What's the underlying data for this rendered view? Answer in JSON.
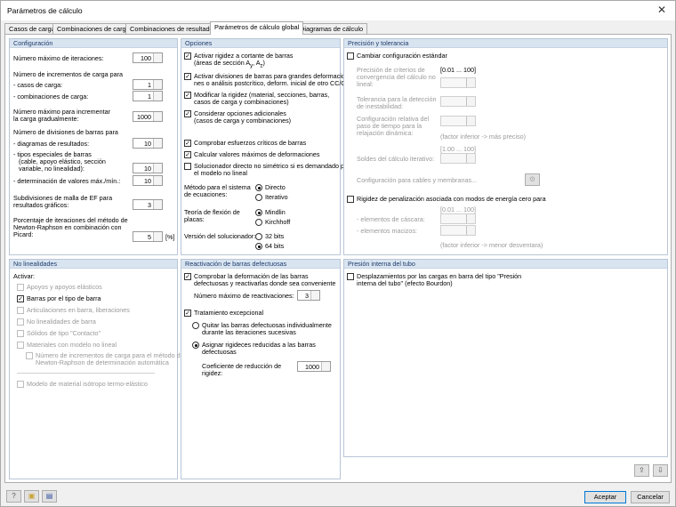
{
  "window": {
    "title": "Parámetros de cálculo",
    "close_icon": "close-icon"
  },
  "tabs": [
    "Casos de carga",
    "Combinaciones de carga",
    "Combinaciones de resultados",
    "Parámetros de cálculo global",
    "Diagramas de cálculo"
  ],
  "config": {
    "header": "Configuración",
    "max_iter_label": "Número máximo de iteraciones:",
    "max_iter": "100",
    "load_incr_label": "Número de incrementos de carga para",
    "load_cases_label": "- casos de carga:",
    "load_cases": "1",
    "load_combos_label": "- combinaciones de carga:",
    "load_combos": "1",
    "max_incr_label1": "Número máximo para incrementar",
    "max_incr_label2": "la carga gradualmente:",
    "max_incr": "1000",
    "member_div_label": "Número de divisiones de barras para",
    "result_diag_label": "- diagramas de resultados:",
    "result_diag": "10",
    "special_label1": "- tipos especiales de barras",
    "special_label2": "(cable, apoyo elástico, sección",
    "special_label3": "variable, no linealidad):",
    "special": "10",
    "max_min_label": "- determinación de valores máx./mín.:",
    "max_min": "10",
    "fe_label1": "Subdivisiones de malla de EF para",
    "fe_label2": "resultados gráficos:",
    "fe": "3",
    "pct_label1": "Porcentaje de iteraciones del método de",
    "pct_label2": "Newton-Raphson en combinación con",
    "pct_label3": "Picard:",
    "pct": "5",
    "pct_unit": "[%]"
  },
  "options": {
    "header": "Opciones",
    "opt1a": "Activar rigidez a cortante de barras",
    "opt1b": "(áreas de sección A",
    "opt1_sub1": "y",
    "opt1_sep": ", A",
    "opt1_sub2": "z",
    "opt1_close": ")",
    "opt2a": "Activar divisiones de barras para grandes deformacio-",
    "opt2b": "nes o análisis postcrítico, deform. inicial de otro CC/CO",
    "opt3a": "Modificar la rigidez (material, secciones, barras,",
    "opt3b": "casos de carga y combinaciones)",
    "opt4a": "Considerar opciones adicionales",
    "opt4b": "(casos de carga y combinaciones)",
    "opt5": "Comprobar esfuerzos críticos de barras",
    "opt6": "Calcular valores máximos de deformaciones",
    "opt7a": "Solucionador directo no simétrico si es demandado por",
    "opt7b": "el modelo no lineal",
    "method_label1": "Método para el sistema",
    "method_label2": "de ecuaciones:",
    "method_direct": "Directo",
    "method_iter": "Iterativo",
    "plate_label1": "Teoría de flexión de",
    "plate_label2": "placas:",
    "plate_mindlin": "Mindlin",
    "plate_kirchhoff": "Kirchhoff",
    "solver_label": "Versión del solucionador:",
    "solver_32": "32 bits",
    "solver_64": "64 bits"
  },
  "precision": {
    "header": "Precisión y tolerancia",
    "change_std": "Cambiar configuración estándar",
    "conv1": "Precisión de criterios de",
    "conv2": "convergencia del cálculo no",
    "conv3": "lineal:",
    "range1": "[0.01 ... 100]",
    "tol1": "Tolerancia para la detección",
    "tol2": "de inestabilidad:",
    "rel1": "Configuración relativa del",
    "rel2": "paso de tiempo para la",
    "rel3": "relajación dinámica:",
    "factor_note": "(factor inferior -> más preciso)",
    "range2": "[1.00 ... 100]",
    "iter_solver": "Soldes del cálculo iterativo:",
    "cables": "Configuración para cables y membranas...",
    "penalty": "Rigidez de penalización asociada con modos de energía cero para",
    "range3": "[0.01 ... 100]",
    "shell": "- elementos de cáscara:",
    "solid": "- elementos macizos:",
    "factor_note2": "(factor inferior -> menor desventara)"
  },
  "nonlin": {
    "header": "No linealidades",
    "activate": "Activar:",
    "n1": "Apoyos y apoyos elásticos",
    "n2": "Barras por el tipo de barra",
    "n3": "Articulaciones en barra, liberaciones",
    "n4": "No linealidades de barra",
    "n5": "Sólidos de tipo \"Contacto\"",
    "n6": "Materiales con modelo no lineal",
    "n7a": "Número de incrementos de carga para el método de",
    "n7b": "Newton-Raphson de determinación automática",
    "n8": "Modelo de material isótropo termo-elástico"
  },
  "reactivation": {
    "header": "Reactivación de barras defectuosas",
    "r1a": "Comprobar la deformación de las barras",
    "r1b": "defectuosas y reactivarlas donde sea conveniente",
    "max_react": "Número máximo de reactivaciones:",
    "max_react_val": "3",
    "exc": "Tratamiento excepcional",
    "ex1a": "Quitar las barras defectuosas individualmente",
    "ex1b": "durante las iteraciones sucesivas",
    "ex2a": "Asignar rigideces reducidas a las barras",
    "ex2b": "defectuosas",
    "coef1": "Coeficiente de reducción de",
    "coef2": "rigidez:",
    "coef_val": "1000"
  },
  "pipe": {
    "header": "Presión interna del tubo",
    "p1a": "Desplazamientos por las cargas en barra del tipo \"Presión",
    "p1b": "interna del tubo\" (efecto Bourdon)"
  },
  "footer": {
    "ok": "Aceptar",
    "cancel": "Cancelar",
    "icons": [
      "help-icon",
      "open-icon",
      "save-icon"
    ]
  }
}
